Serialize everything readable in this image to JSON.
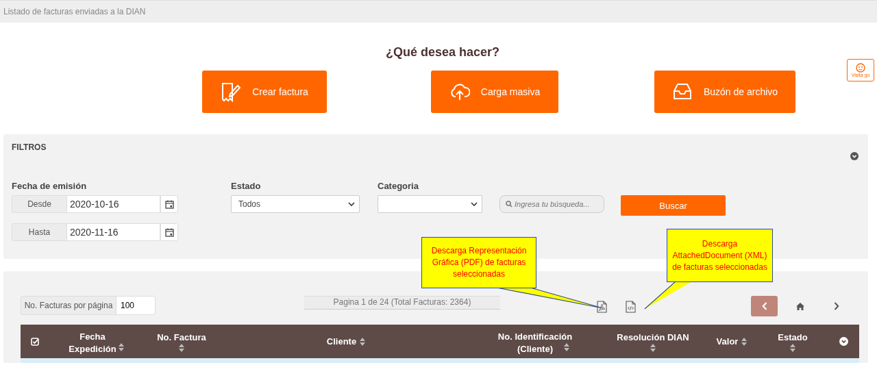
{
  "breadcrumb": "Listado de facturas enviadas a la DIAN",
  "visit_guide": {
    "label": "Visita gu"
  },
  "heading": "¿Qué desea hacer?",
  "actions": [
    {
      "kind": "create",
      "label": "Crear factura"
    },
    {
      "kind": "upload",
      "label": "Carga masiva"
    },
    {
      "kind": "inbox",
      "label": "Buzón de archivo"
    }
  ],
  "filters": {
    "title": "FILTROS",
    "date_label": "Fecha de emisión",
    "dates": [
      {
        "addon": "Desde",
        "value": "2020-10-16"
      },
      {
        "addon": "Hasta",
        "value": "2020-11-16"
      }
    ],
    "status": {
      "label": "Estado",
      "value": "Todos"
    },
    "category": {
      "label": "Categoria"
    },
    "search": {
      "placeholder": "Ingresa tu búsqueda..."
    },
    "submit": "Buscar"
  },
  "table": {
    "per_page": {
      "label": "No. Facturas por página",
      "value": "100"
    },
    "page_info": "Pagina 1 de 24 (Total Facturas: 2364)",
    "downloads": [
      {
        "kind": "pdf"
      },
      {
        "kind": "xml"
      }
    ],
    "columns": [
      {
        "kind": "checkbox"
      },
      {
        "kind": "text",
        "label": "Fecha Expedición",
        "sortable": true
      },
      {
        "kind": "text",
        "label": "No. Factura",
        "sortable": true
      },
      {
        "kind": "text",
        "label": "Cliente",
        "sortable": true
      },
      {
        "kind": "text",
        "label": "No. Identificación (Cliente)",
        "sortable": true
      },
      {
        "kind": "text",
        "label": "Resolución DIAN",
        "sortable": true
      },
      {
        "kind": "text",
        "label": "Valor",
        "sortable": true
      },
      {
        "kind": "text",
        "label": "Estado",
        "sortable": true
      },
      {
        "kind": "expand"
      }
    ]
  },
  "annotations": [
    {
      "text": "Descarga Representación Gráfica (PDF) de facturas seleccionadas"
    },
    {
      "text": "Descarga AttachedDocument (XML) de facturas seleccionadas"
    }
  ]
}
